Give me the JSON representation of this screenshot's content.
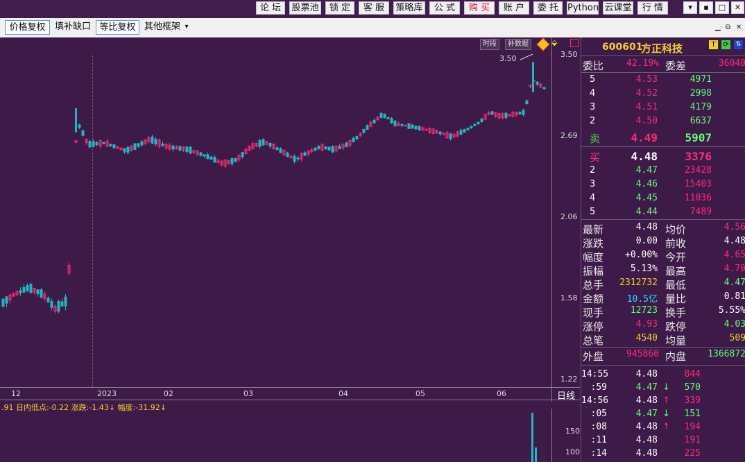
{
  "menu": [
    "论 坛",
    "股票池",
    "锁 定",
    "客 服",
    "策略库",
    "公 式",
    "购 买",
    "账 户",
    "委 托",
    "Python",
    "云课堂",
    "行 情"
  ],
  "window_controls": [
    "▾",
    "▪",
    "□",
    "✕"
  ],
  "toolbar": {
    "price_adjust": "价格复权",
    "fill_gap": "填补缺口",
    "ratio_adjust": "等比复权",
    "other_frames": "其他框架",
    "dropdown": "▾"
  },
  "chart_tags": {
    "time_segment": "时段",
    "fill_data": "补数据"
  },
  "chart_data": {
    "type": "candlestick",
    "y_ticks": [
      "3.50",
      "2.69",
      "2.06",
      "1.58",
      "1.22"
    ],
    "x_labels": [
      "12",
      "2023",
      "02",
      "03",
      "04",
      "05",
      "06"
    ],
    "period": "日线",
    "high_annotation": "3.50",
    "volume_ticks": [
      "150",
      "100"
    ],
    "indicator_text": ".91 日内低点:-0.22 涨跌:-1.43↓ 幅度:-31.92↓"
  },
  "quote": {
    "code": "600601",
    "name": "方正科技",
    "ratio_label": "委比",
    "ratio_value": "42.19%",
    "diff_label": "委差",
    "diff_value": "36040",
    "sell": [
      {
        "level": "5",
        "price": "4.53",
        "vol": "4971"
      },
      {
        "level": "4",
        "price": "4.52",
        "vol": "2998"
      },
      {
        "level": "3",
        "price": "4.51",
        "vol": "4179"
      },
      {
        "level": "2",
        "price": "4.50",
        "vol": "6637"
      },
      {
        "level": "卖",
        "price": "4.49",
        "vol": "5907"
      }
    ],
    "buy": [
      {
        "level": "买",
        "price": "4.48",
        "vol": "3376"
      },
      {
        "level": "2",
        "price": "4.47",
        "vol": "23428"
      },
      {
        "level": "3",
        "price": "4.46",
        "vol": "15403"
      },
      {
        "level": "4",
        "price": "4.45",
        "vol": "11036"
      },
      {
        "level": "5",
        "price": "4.44",
        "vol": "7489"
      }
    ],
    "stats": [
      {
        "l1": "最新",
        "v1": "4.48",
        "c1": "wht",
        "l2": "均价",
        "v2": "4.56",
        "c2": "red"
      },
      {
        "l1": "涨跌",
        "v1": "0.00",
        "c1": "wht",
        "l2": "前收",
        "v2": "4.48",
        "c2": "wht"
      },
      {
        "l1": "幅度",
        "v1": "+0.00%",
        "c1": "wht",
        "l2": "今开",
        "v2": "4.65",
        "c2": "red"
      },
      {
        "l1": "振幅",
        "v1": "5.13%",
        "c1": "wht",
        "l2": "最高",
        "v2": "4.70",
        "c2": "red"
      },
      {
        "l1": "总手",
        "v1": "2312732",
        "c1": "yel",
        "l2": "最低",
        "v2": "4.47",
        "c2": "grn"
      },
      {
        "l1": "金额",
        "v1": "10.5亿",
        "c1": "cyn",
        "l2": "量比",
        "v2": "0.81",
        "c2": "wht"
      },
      {
        "l1": "现手",
        "v1": "12723",
        "c1": "grn",
        "l2": "换手",
        "v2": "5.55%",
        "c2": "wht"
      },
      {
        "l1": "涨停",
        "v1": "4.93",
        "c1": "red",
        "l2": "跌停",
        "v2": "4.03",
        "c2": "grn"
      },
      {
        "l1": "总笔",
        "v1": "4540",
        "c1": "yel",
        "l2": "均量",
        "v2": "509",
        "c2": "yel"
      }
    ],
    "outer_label": "外盘",
    "outer_value": "945860",
    "inner_label": "内盘",
    "inner_value": "1366872",
    "ticks": [
      {
        "t": "14:55",
        "p": "4.48",
        "pc": "wht",
        "a": "",
        "ac": "wht",
        "v": "844",
        "vc": "red"
      },
      {
        "t": ":59",
        "p": "4.47",
        "pc": "grn",
        "a": "↓",
        "ac": "grn",
        "v": "570",
        "vc": "grn"
      },
      {
        "t": "14:56",
        "p": "4.48",
        "pc": "wht",
        "a": "↑",
        "ac": "red",
        "v": "339",
        "vc": "red"
      },
      {
        "t": ":05",
        "p": "4.47",
        "pc": "grn",
        "a": "↓",
        "ac": "grn",
        "v": "151",
        "vc": "grn"
      },
      {
        "t": ":08",
        "p": "4.48",
        "pc": "wht",
        "a": "↑",
        "ac": "red",
        "v": "194",
        "vc": "red"
      },
      {
        "t": ":11",
        "p": "4.48",
        "pc": "wht",
        "a": "",
        "ac": "wht",
        "v": "191",
        "vc": "red"
      },
      {
        "t": ":14",
        "p": "4.48",
        "pc": "wht",
        "a": "",
        "ac": "wht",
        "v": "225",
        "vc": "red"
      }
    ]
  }
}
